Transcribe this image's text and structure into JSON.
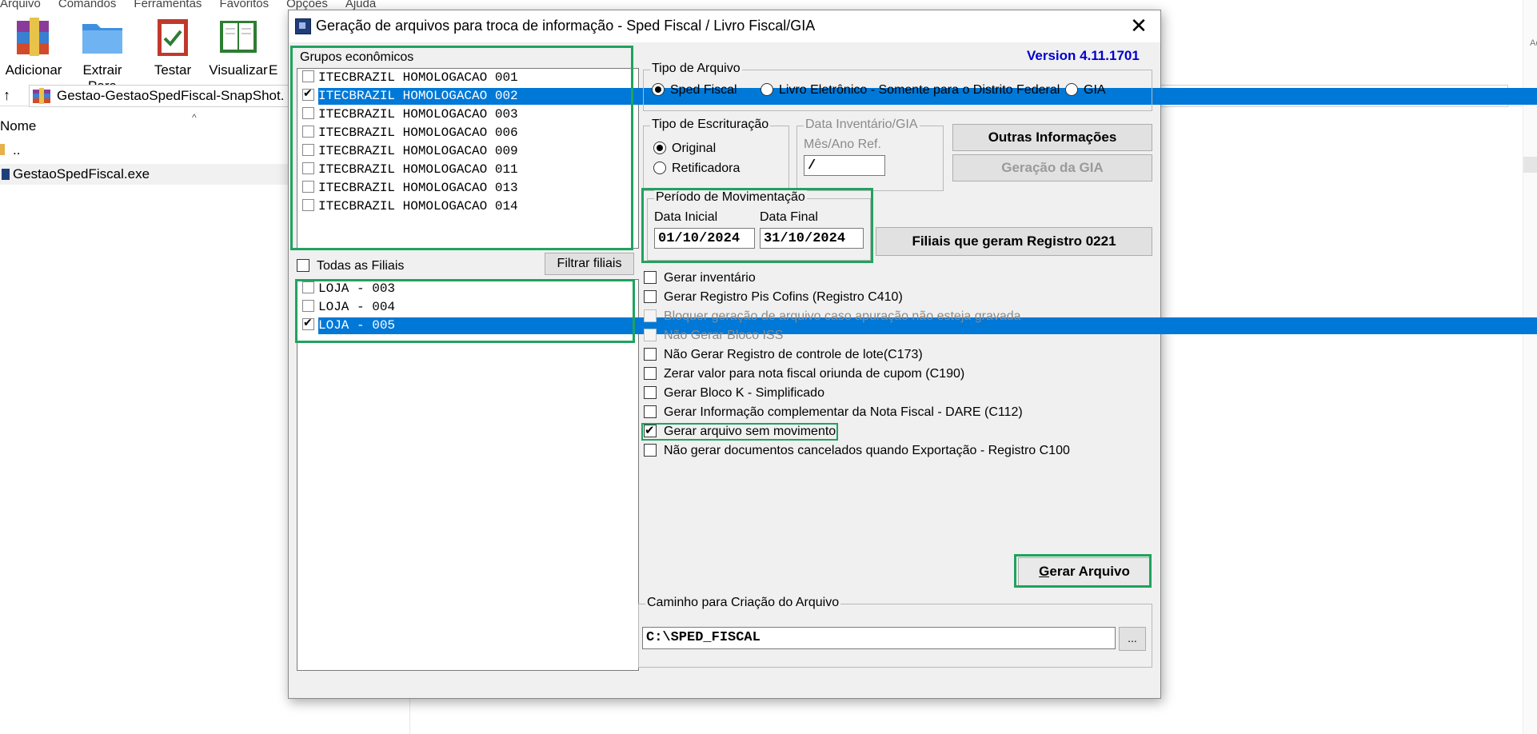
{
  "background": {
    "menu": [
      "Arquivo",
      "Comandos",
      "Ferramentas",
      "Favoritos",
      "Opções",
      "Ajuda"
    ],
    "toolbar": [
      {
        "label": "Adicionar",
        "icon": "archive-add-icon"
      },
      {
        "label": "Extrair Para",
        "icon": "folder-extract-icon"
      },
      {
        "label": "Testar",
        "icon": "clipboard-check-icon"
      },
      {
        "label": "Visualizar",
        "icon": "book-view-icon"
      },
      {
        "label": "E"
      }
    ],
    "path": "Gestao-GestaoSpedFiscal-SnapShot.",
    "column_header": "Nome",
    "rows": [
      "..",
      "GestaoSpedFiscal.exe"
    ],
    "edge_label": "Ac"
  },
  "dialog": {
    "title": "Geração de arquivos para troca de informação - Sped Fiscal / Livro Fiscal/GIA",
    "close_label": "✕",
    "version": "Version 4.11.1701",
    "grupos": {
      "label": "Grupos econômicos",
      "items": [
        {
          "label": "ITECBRAZIL HOMOLOGACAO 001",
          "checked": false,
          "selected": false
        },
        {
          "label": "ITECBRAZIL HOMOLOGACAO 002",
          "checked": true,
          "selected": true
        },
        {
          "label": "ITECBRAZIL HOMOLOGACAO 003",
          "checked": false,
          "selected": false
        },
        {
          "label": "ITECBRAZIL HOMOLOGACAO 006",
          "checked": false,
          "selected": false
        },
        {
          "label": "ITECBRAZIL HOMOLOGACAO 009",
          "checked": false,
          "selected": false
        },
        {
          "label": "ITECBRAZIL HOMOLOGACAO 011",
          "checked": false,
          "selected": false
        },
        {
          "label": "ITECBRAZIL HOMOLOGACAO 013",
          "checked": false,
          "selected": false
        },
        {
          "label": "ITECBRAZIL HOMOLOGACAO 014",
          "checked": false,
          "selected": false
        }
      ]
    },
    "todas_filiais_label": "Todas as Filiais",
    "filtrar_label": "Filtrar filiais",
    "filiais": [
      {
        "label": "LOJA - 003",
        "checked": false,
        "selected": false
      },
      {
        "label": "LOJA - 004",
        "checked": false,
        "selected": false
      },
      {
        "label": "LOJA - 005",
        "checked": true,
        "selected": true
      }
    ],
    "tipo_arquivo": {
      "label": "Tipo de Arquivo",
      "options": [
        "Sped Fiscal",
        "Livro Eletrônico - Somente para o Distrito Federal",
        "GIA"
      ],
      "selected": "Sped Fiscal"
    },
    "tipo_escrituracao": {
      "label": "Tipo de Escrituração",
      "options": [
        "Original",
        "Retificadora"
      ],
      "selected": "Original"
    },
    "inventario": {
      "label": "Data Inventário/GIA",
      "field_label": "Mês/Ano Ref.",
      "value": "/"
    },
    "outras_label": "Outras Informações",
    "gia_label": "Geração da GIA",
    "periodo": {
      "label": "Período de Movimentação",
      "inicial_label": "Data Inicial",
      "inicial": "01/10/2024",
      "final_label": "Data Final",
      "final": "31/10/2024"
    },
    "filiais_0221_label": "Filiais que geram Registro 0221",
    "options": [
      {
        "label": "Gerar inventário",
        "checked": false,
        "enabled": true
      },
      {
        "label": "Gerar Registro Pis Cofins (Registro C410)",
        "checked": false,
        "enabled": true
      },
      {
        "label": "Bloquer geração de arquivo caso apuração não esteja gravada",
        "checked": false,
        "enabled": false
      },
      {
        "label": "Não Gerar Bloco ISS",
        "checked": false,
        "enabled": false
      },
      {
        "label": "Não Gerar Registro de controle de lote(C173)",
        "checked": false,
        "enabled": true
      },
      {
        "label": "Zerar valor para nota fiscal oriunda de cupom (C190)",
        "checked": false,
        "enabled": true
      },
      {
        "label": "Gerar Bloco K  -  Simplificado",
        "checked": false,
        "enabled": true
      },
      {
        "label": "Gerar Informação complementar da Nota Fiscal - DARE (C112)",
        "checked": false,
        "enabled": true
      },
      {
        "label": "Gerar arquivo sem movimento",
        "checked": true,
        "enabled": true
      },
      {
        "label": "Não gerar documentos cancelados quando Exportação - Registro C100",
        "checked": false,
        "enabled": true
      }
    ],
    "gerar_label": "Gerar Arquivo",
    "caminho": {
      "label": "Caminho para Criação do Arquivo",
      "value": "C:\\SPED_FISCAL",
      "browse_label": "..."
    }
  }
}
